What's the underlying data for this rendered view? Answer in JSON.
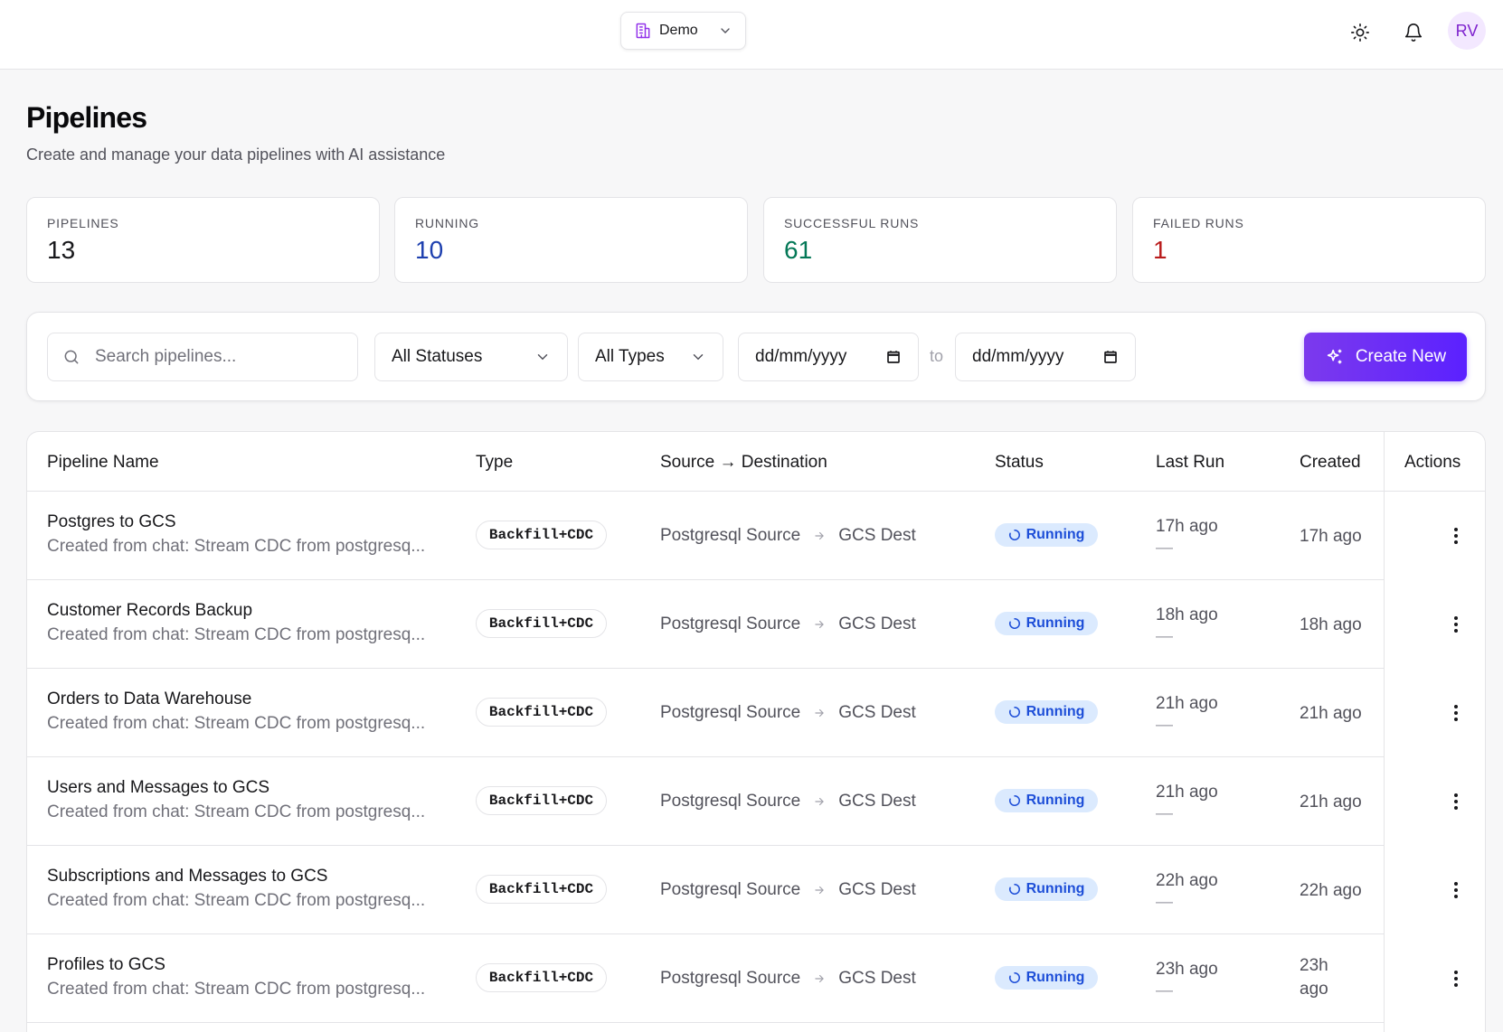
{
  "header": {
    "workspace_label": "Demo",
    "avatar_initials": "RV"
  },
  "page": {
    "title": "Pipelines",
    "subtitle": "Create and manage your data pipelines with AI assistance"
  },
  "stats": [
    {
      "label": "PIPELINES",
      "value": "13",
      "color": "#18181b"
    },
    {
      "label": "RUNNING",
      "value": "10",
      "color": "#1e40af"
    },
    {
      "label": "SUCCESSFUL RUNS",
      "value": "61",
      "color": "#047857"
    },
    {
      "label": "FAILED RUNS",
      "value": "1",
      "color": "#b91c1c"
    }
  ],
  "filters": {
    "search_placeholder": "Search pipelines...",
    "status_select": "All Statuses",
    "type_select": "All Types",
    "date_from": "dd/mm/yyyy",
    "date_to": "dd/mm/yyyy",
    "to_label": "to",
    "create_label": "Create New"
  },
  "table": {
    "headers": {
      "name": "Pipeline Name",
      "type": "Type",
      "src_dest": "Source → Destination",
      "status": "Status",
      "last_run": "Last Run",
      "created": "Created",
      "actions": "Actions"
    },
    "rows": [
      {
        "name": "Postgres to GCS",
        "desc": "Created from chat: Stream CDC from postgresq...",
        "type": "Backfill+CDC",
        "source": "Postgresql Source",
        "dest": "GCS Dest",
        "status": "Running",
        "last_run": "17h ago",
        "last_run_sub": "—",
        "created": "17h ago"
      },
      {
        "name": "Customer Records Backup",
        "desc": "Created from chat: Stream CDC from postgresq...",
        "type": "Backfill+CDC",
        "source": "Postgresql Source",
        "dest": "GCS Dest",
        "status": "Running",
        "last_run": "18h ago",
        "last_run_sub": "—",
        "created": "18h ago"
      },
      {
        "name": "Orders to Data Warehouse",
        "desc": "Created from chat: Stream CDC from postgresq...",
        "type": "Backfill+CDC",
        "source": "Postgresql Source",
        "dest": "GCS Dest",
        "status": "Running",
        "last_run": "21h ago",
        "last_run_sub": "—",
        "created": "21h ago"
      },
      {
        "name": "Users and Messages to GCS",
        "desc": "Created from chat: Stream CDC from postgresq...",
        "type": "Backfill+CDC",
        "source": "Postgresql Source",
        "dest": "GCS Dest",
        "status": "Running",
        "last_run": "21h ago",
        "last_run_sub": "—",
        "created": "21h ago"
      },
      {
        "name": "Subscriptions and Messages to GCS",
        "desc": "Created from chat: Stream CDC from postgresq...",
        "type": "Backfill+CDC",
        "source": "Postgresql Source",
        "dest": "GCS Dest",
        "status": "Running",
        "last_run": "22h ago",
        "last_run_sub": "—",
        "created": "22h ago"
      },
      {
        "name": "Profiles to GCS",
        "desc": "Created from chat: Stream CDC from postgresq...",
        "type": "Backfill+CDC",
        "source": "Postgresql Source",
        "dest": "GCS Dest",
        "status": "Running",
        "last_run": "23h ago",
        "last_run_sub": "—",
        "created": "23h ago",
        "created_wrap": true
      }
    ]
  },
  "icons": {
    "workspace": "building-icon",
    "theme": "sun-icon",
    "notifications": "bell-icon",
    "search": "search-icon",
    "create": "sparkles-icon",
    "row_actions": "kebab-menu-icon"
  }
}
